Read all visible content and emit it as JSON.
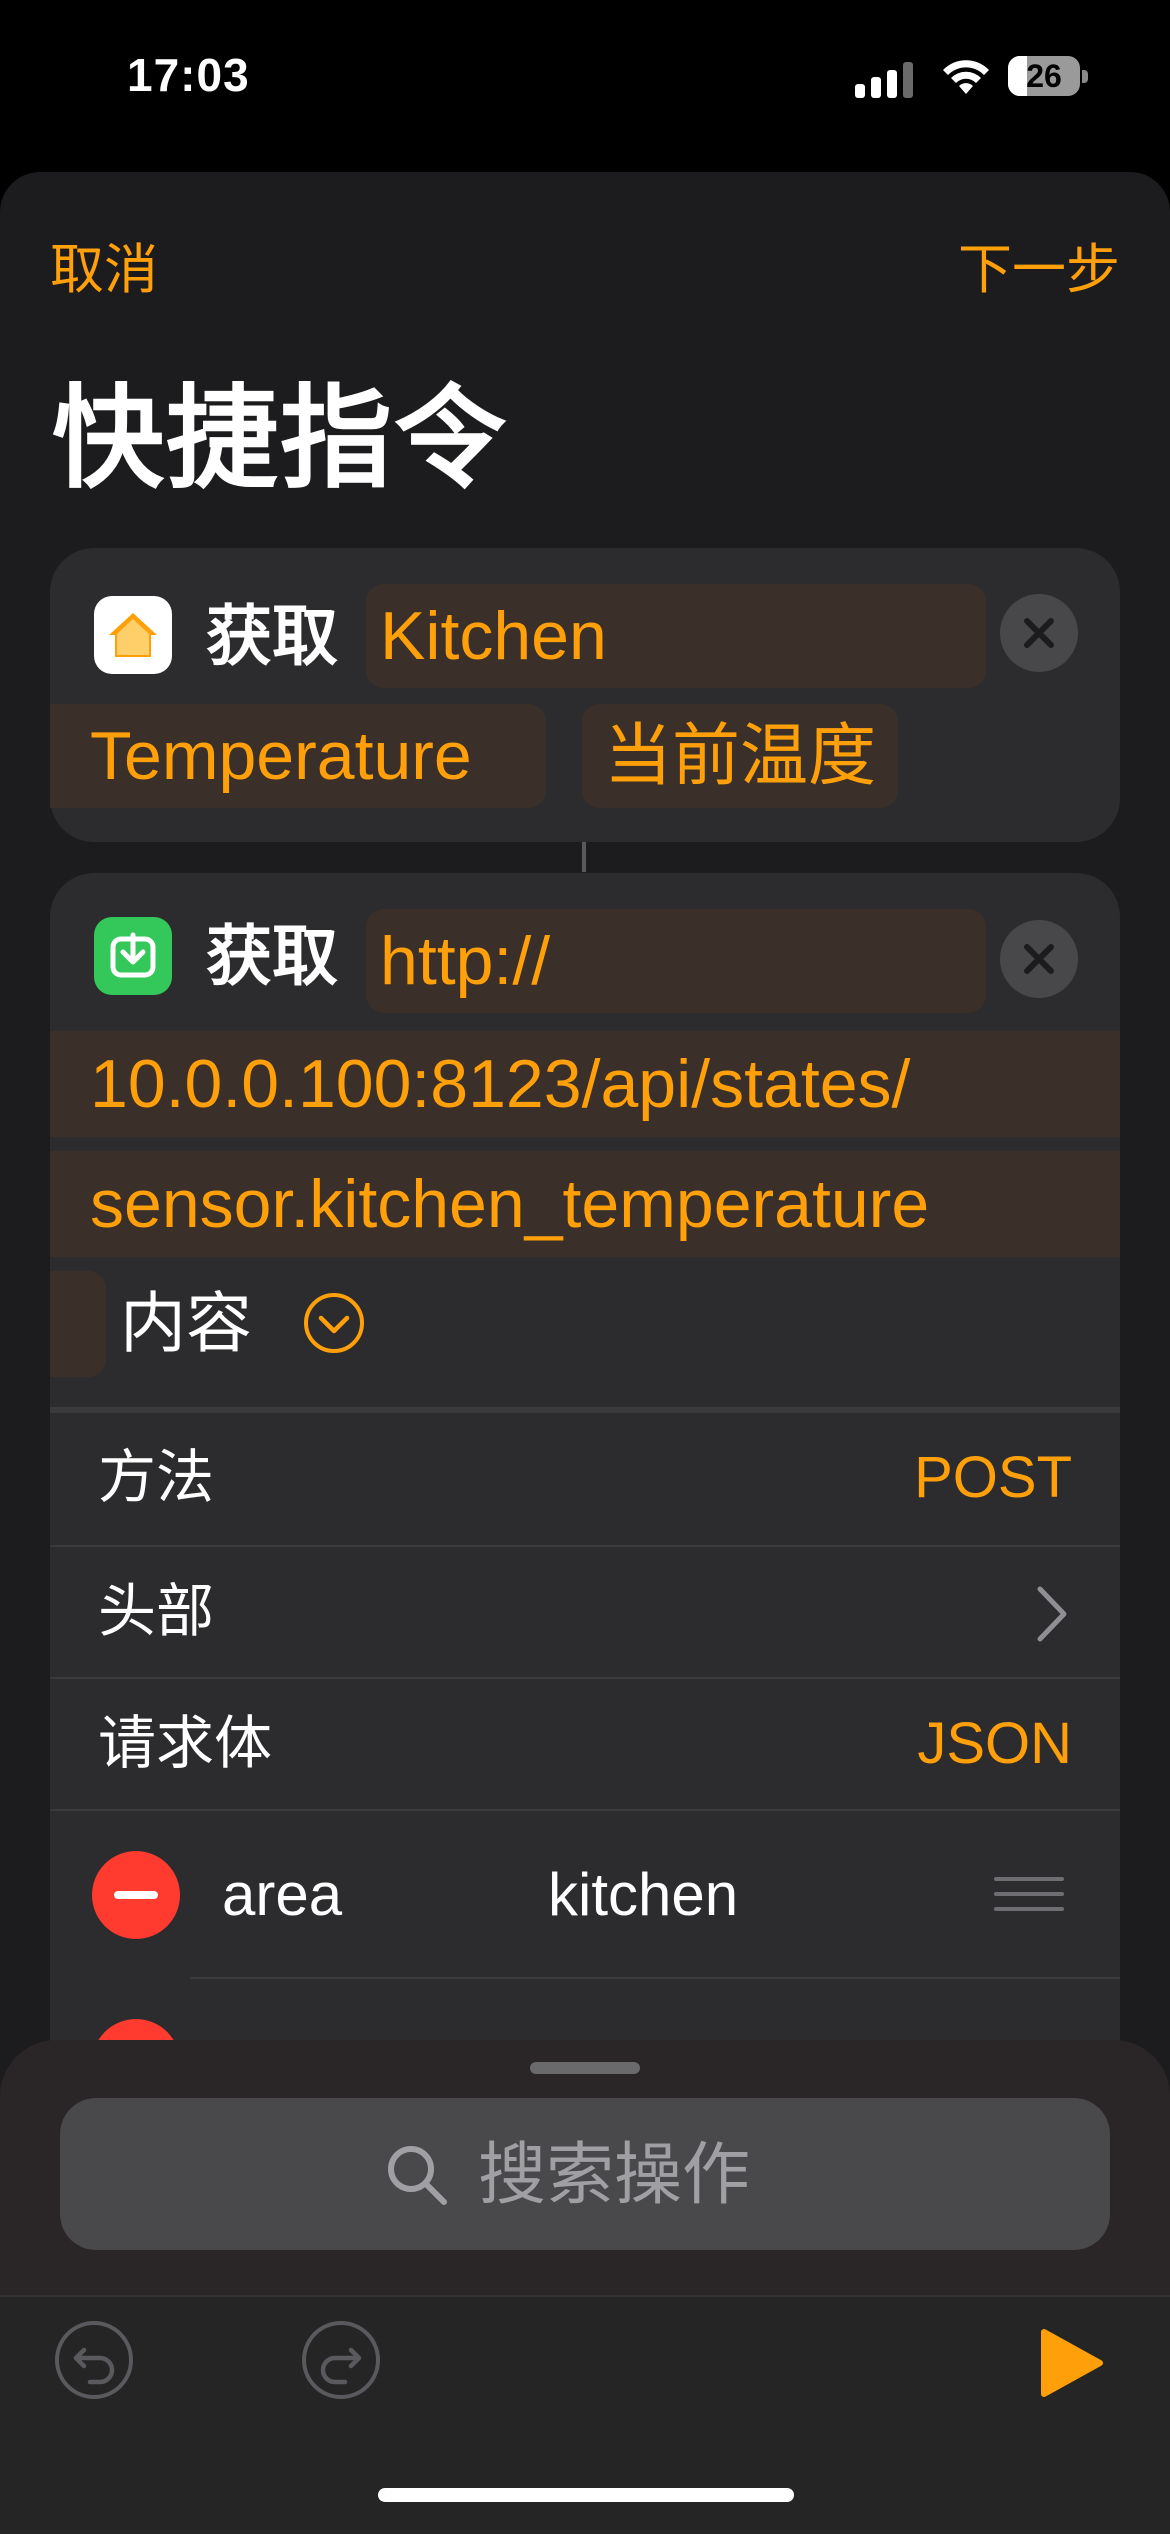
{
  "status_bar": {
    "time": "17:03",
    "battery": "26",
    "battery_level": 0.26
  },
  "nav": {
    "cancel": "取消",
    "next": "下一步"
  },
  "title": "快捷指令",
  "action1": {
    "verb": "获取",
    "device_token_line1": "Kitchen",
    "device_token_line2": "Temperature",
    "property_token": "当前温度"
  },
  "action2": {
    "verb": "获取",
    "url_part1": "http://",
    "url_part2": "10.0.0.100:8123/api/states/",
    "url_part3": "sensor.kitchen_temperature",
    "content_label": "内容"
  },
  "options": [
    {
      "label": "方法",
      "value": "POST"
    },
    {
      "label": "头部",
      "value": ""
    },
    {
      "label": "请求体",
      "value": "JSON"
    }
  ],
  "body_fields": [
    {
      "key": "area",
      "value": "kitchen"
    }
  ],
  "search": {
    "placeholder": "搜索操作"
  },
  "colors": {
    "accent": "#ff9f0a",
    "delete": "#ff3b30",
    "home_icon_bg": "#ffffff",
    "download_icon_bg": "#34c759"
  }
}
